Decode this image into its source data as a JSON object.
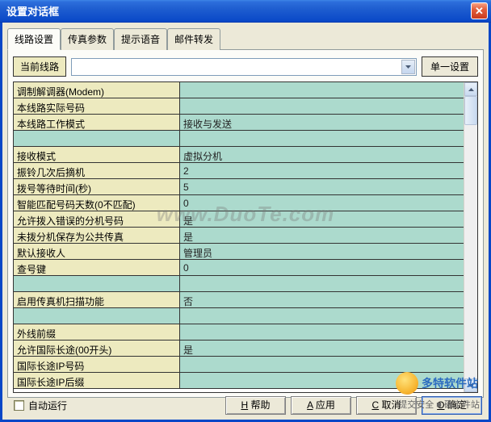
{
  "window": {
    "title": "设置对话框",
    "close_label": "✕"
  },
  "tabs": {
    "items": [
      {
        "label": "线路设置",
        "active": true
      },
      {
        "label": "传真参数",
        "active": false
      },
      {
        "label": "提示语音",
        "active": false
      },
      {
        "label": "邮件转发",
        "active": false
      }
    ]
  },
  "line_row": {
    "label": "当前线路",
    "selected": "",
    "single_button": "单一设置"
  },
  "properties": [
    {
      "label": "调制解调器(Modem)",
      "value": ""
    },
    {
      "label": "本线路实际号码",
      "value": ""
    },
    {
      "label": "本线路工作模式",
      "value": "接收与发送"
    },
    {
      "spacer": true
    },
    {
      "label": "接收模式",
      "value": "虚拟分机"
    },
    {
      "label": "振铃几次后摘机",
      "value": "2"
    },
    {
      "label": "拨号等待时间(秒)",
      "value": "5"
    },
    {
      "label": "智能匹配号码天数(0不匹配)",
      "value": "0"
    },
    {
      "label": "允许拨入错误的分机号码",
      "value": "是"
    },
    {
      "label": "未拨分机保存为公共传真",
      "value": "是"
    },
    {
      "label": "默认接收人",
      "value": "管理员"
    },
    {
      "label": "查号键",
      "value": "0"
    },
    {
      "spacer": true
    },
    {
      "label": "启用传真机扫描功能",
      "value": "否"
    },
    {
      "spacer": true
    },
    {
      "label": "外线前缀",
      "value": ""
    },
    {
      "label": "允许国际长途(00开头)",
      "value": "是"
    },
    {
      "label": "国际长途IP号码",
      "value": ""
    },
    {
      "label": "国际长途IP后缀",
      "value": ""
    }
  ],
  "bottom": {
    "auto_run_label": "自动运行",
    "auto_run_checked": false,
    "buttons": {
      "help": {
        "mnemonic": "H",
        "text": "帮助"
      },
      "apply": {
        "mnemonic": "A",
        "text": "应用"
      },
      "cancel": {
        "mnemonic": "C",
        "text": "取消"
      },
      "ok": {
        "mnemonic": "O",
        "text": "确定"
      }
    }
  },
  "watermark": "www.DuoTe.com",
  "brand": "多特软件站",
  "slogan": "提交安全 ■ 确定件站"
}
